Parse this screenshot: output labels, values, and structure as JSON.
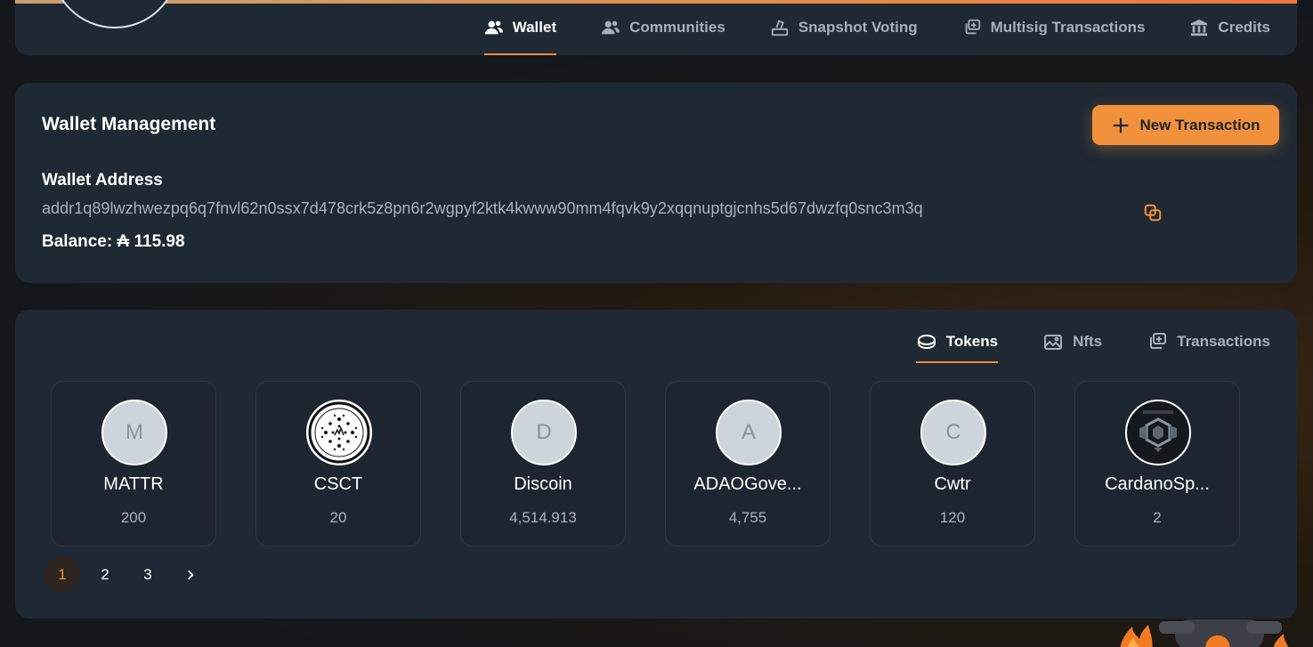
{
  "nav": {
    "tabs": [
      {
        "label": "Wallet",
        "icon": "users-icon",
        "active": true
      },
      {
        "label": "Communities",
        "icon": "users-icon",
        "active": false
      },
      {
        "label": "Snapshot Voting",
        "icon": "ballot-box-icon",
        "active": false
      },
      {
        "label": "Multisig Transactions",
        "icon": "multisig-icon",
        "active": false
      },
      {
        "label": "Credits",
        "icon": "bank-icon",
        "active": false
      }
    ]
  },
  "wallet": {
    "title": "Wallet Management",
    "new_transaction_label": "New Transaction",
    "address_label": "Wallet Address",
    "address": "addr1q89lwzhwezpq6q7fnvl62n0ssx7d478crk5z8pn6r2wgpyf2ktk4kwww90mm4fqvk9y2xqqnuptgjcnhs5d67dwzfq0snc3m3q",
    "balance_text": "Balance: ₳ 115.98"
  },
  "assets": {
    "tabs": [
      {
        "label": "Tokens",
        "icon": "coin-icon",
        "active": true
      },
      {
        "label": "Nfts",
        "icon": "image-icon",
        "active": false
      },
      {
        "label": "Transactions",
        "icon": "transactions-icon",
        "active": false
      }
    ],
    "tokens": [
      {
        "initial": "M",
        "name": "MATTR",
        "amount": "200"
      },
      {
        "initial": "",
        "name": "CSCT",
        "amount": "20"
      },
      {
        "initial": "D",
        "name": "Discoin",
        "amount": "4,514.913"
      },
      {
        "initial": "A",
        "name": "ADAOGove...",
        "amount": "4,755"
      },
      {
        "initial": "C",
        "name": "Cwtr",
        "amount": "120"
      },
      {
        "initial": "",
        "name": "CardanoSp...",
        "amount": "2"
      }
    ],
    "pages": [
      "1",
      "2",
      "3"
    ],
    "current_page": "1"
  },
  "colors": {
    "accent": "#f2913b",
    "card": "#1f2933",
    "text_muted": "#a8b2bd"
  }
}
